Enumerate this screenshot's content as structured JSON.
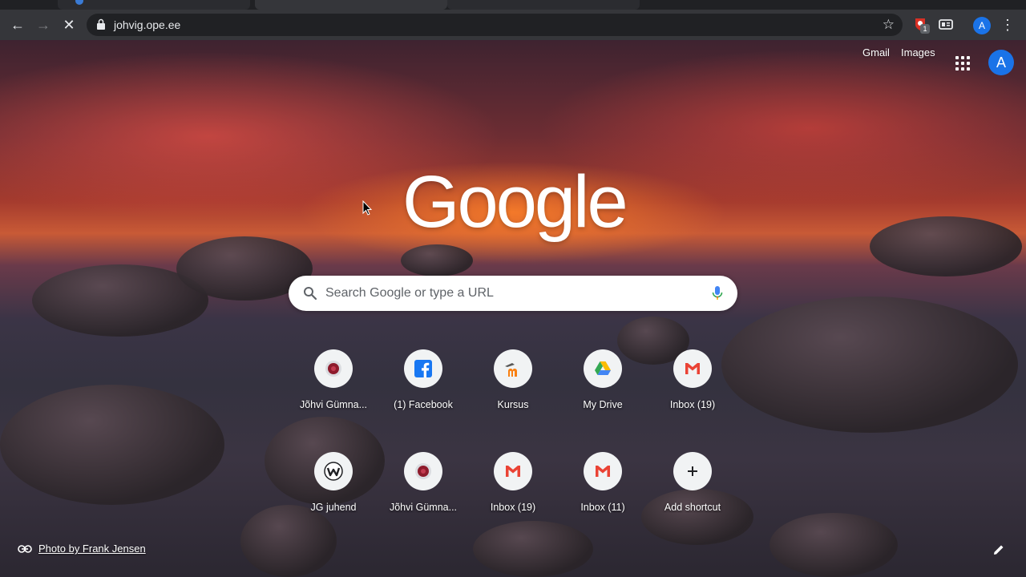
{
  "browser": {
    "url": "johvig.ope.ee",
    "extension_badge": "1",
    "avatar_letter": "A"
  },
  "header": {
    "gmail_label": "Gmail",
    "images_label": "Images",
    "avatar_letter": "A"
  },
  "logo": {
    "text": "Google"
  },
  "search": {
    "placeholder": "Search Google or type a URL"
  },
  "shortcuts": [
    {
      "label": "Jõhvi Gümna...",
      "icon": "school-crest-icon"
    },
    {
      "label": "(1) Facebook",
      "icon": "facebook-icon"
    },
    {
      "label": "Kursus",
      "icon": "moodle-icon"
    },
    {
      "label": "My Drive",
      "icon": "google-drive-icon"
    },
    {
      "label": "Inbox (19)",
      "icon": "gmail-icon"
    },
    {
      "label": "JG juhend",
      "icon": "wix-icon"
    },
    {
      "label": "Jõhvi Gümna...",
      "icon": "school-crest-icon"
    },
    {
      "label": "Inbox (19)",
      "icon": "gmail-icon"
    },
    {
      "label": "Inbox (11)",
      "icon": "gmail-icon"
    },
    {
      "label": "Add shortcut",
      "icon": "plus-icon"
    }
  ],
  "footer": {
    "photo_credit": "Photo by Frank Jensen"
  },
  "colors": {
    "chrome_dark": "#35363a",
    "omnibox": "#202124",
    "avatar_blue": "#1a73e8",
    "gmail_red": "#ea4335"
  }
}
